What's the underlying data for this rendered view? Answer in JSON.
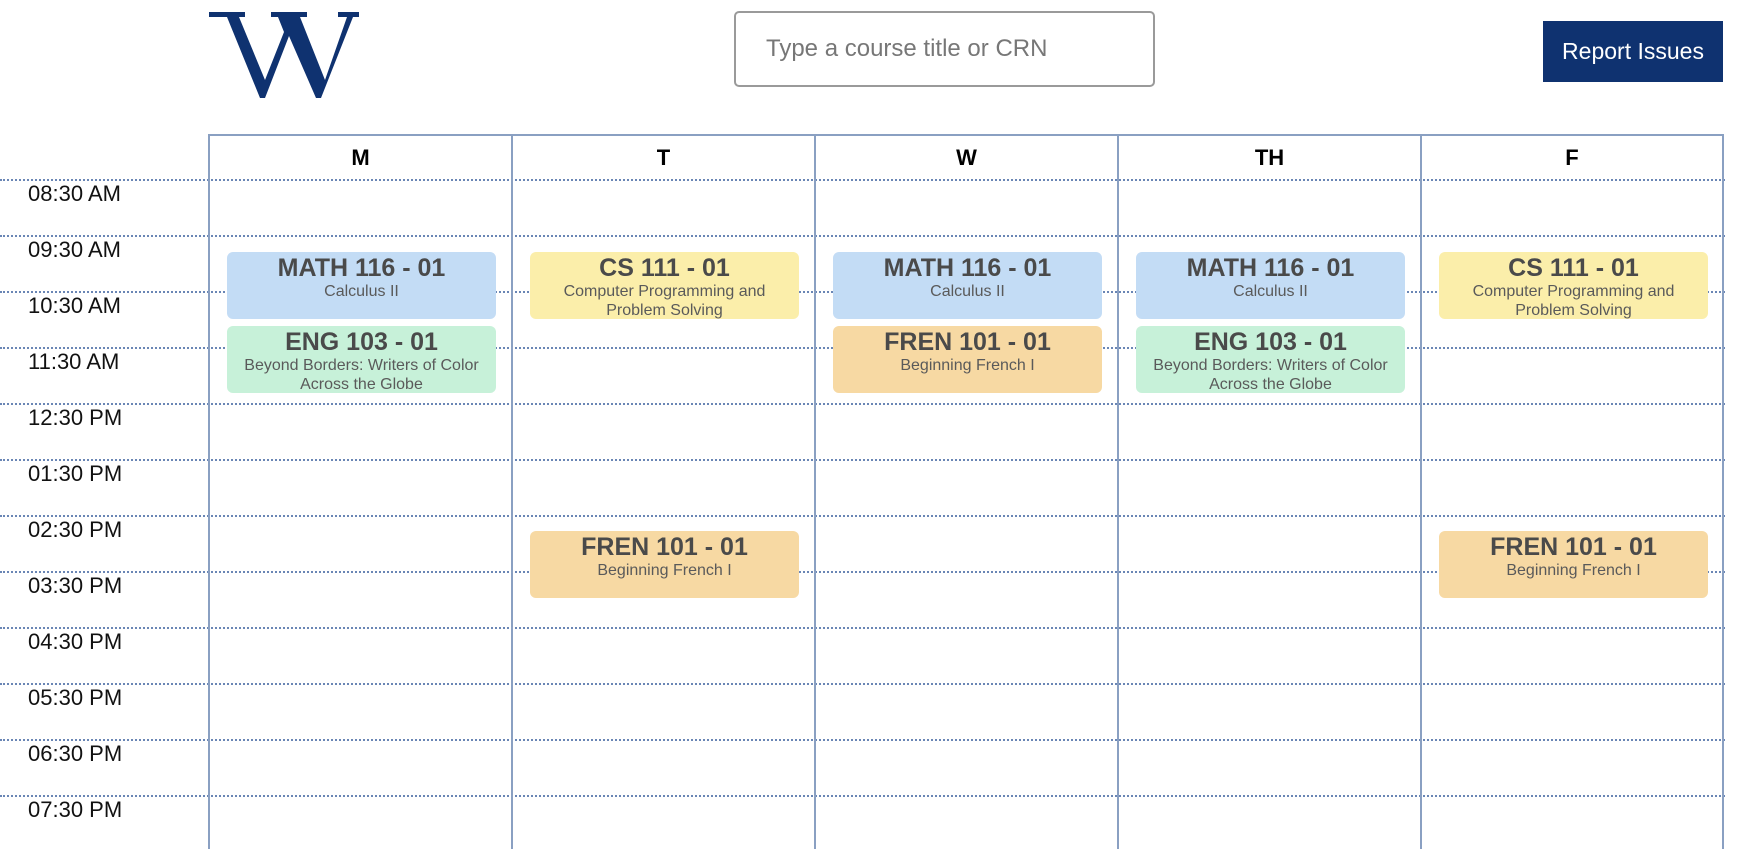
{
  "header": {
    "logo_alt": "W",
    "search_placeholder": "Type a course title or CRN",
    "report_label": "Report Issues"
  },
  "colors": {
    "brand": "#0f3270",
    "math": "#c3dcf5",
    "cs": "#fbeeaa",
    "eng": "#c7f1d9",
    "fren": "#f7d9a3"
  },
  "times": [
    "08:30 AM",
    "09:30 AM",
    "10:30 AM",
    "11:30 AM",
    "12:30 PM",
    "01:30 PM",
    "02:30 PM",
    "03:30 PM",
    "04:30 PM",
    "05:30 PM",
    "06:30 PM",
    "07:30 PM"
  ],
  "days": [
    {
      "label": "M",
      "events": [
        {
          "code": "MATH 116 - 01",
          "title": "Calculus II",
          "color": "math",
          "slot": "10"
        },
        {
          "code": "ENG 103 - 01",
          "title": "Beyond Borders: Writers of Color Across the Globe",
          "color": "eng",
          "slot": "11"
        }
      ]
    },
    {
      "label": "T",
      "events": [
        {
          "code": "CS 111 - 01",
          "title": "Computer Programming and Problem Solving",
          "color": "cs",
          "slot": "10"
        },
        {
          "code": "FREN 101 - 01",
          "title": "Beginning French I",
          "color": "fren",
          "slot": "15"
        }
      ]
    },
    {
      "label": "W",
      "events": [
        {
          "code": "MATH 116 - 01",
          "title": "Calculus II",
          "color": "math",
          "slot": "10"
        },
        {
          "code": "FREN 101 - 01",
          "title": "Beginning French I",
          "color": "fren",
          "slot": "11"
        }
      ]
    },
    {
      "label": "TH",
      "events": [
        {
          "code": "MATH 116 - 01",
          "title": "Calculus II",
          "color": "math",
          "slot": "10"
        },
        {
          "code": "ENG 103 - 01",
          "title": "Beyond Borders: Writers of Color Across the Globe",
          "color": "eng",
          "slot": "11"
        }
      ]
    },
    {
      "label": "F",
      "events": [
        {
          "code": "CS 111 - 01",
          "title": "Computer Programming and Problem Solving",
          "color": "cs",
          "slot": "10"
        },
        {
          "code": "FREN 101 - 01",
          "title": "Beginning French I",
          "color": "fren",
          "slot": "15"
        }
      ]
    }
  ]
}
